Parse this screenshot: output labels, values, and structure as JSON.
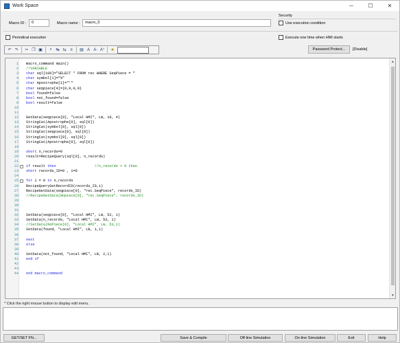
{
  "window": {
    "title": "Work Space",
    "controls": {
      "minimize": "─",
      "maximize": "☐",
      "close": "✕"
    }
  },
  "form": {
    "macro_id_label": "Macro ID :",
    "macro_id_value": "0",
    "macro_name_label": "Macro name :",
    "macro_name_value": "macro_0",
    "periodical_label": "Periodical execution",
    "security_title": "Security",
    "use_exec_condition_label": "Use execution condition",
    "execute_once_label": "Execute one time when HMI starts",
    "password_button": "Password Protect...",
    "disable_status": "[Disable]"
  },
  "toolbar": {
    "icons": [
      "undo-icon",
      "redo-icon",
      "cut-icon",
      "copy-icon",
      "paste-icon",
      "find-icon",
      "replace-icon",
      "replace-all-icon",
      "comment-icon",
      "uncomment-icon",
      "font-increase-icon",
      "font-decrease-icon",
      "font-increase-alt-icon",
      "bookmark-icon"
    ],
    "search_value": ""
  },
  "editor": {
    "lines": [
      {
        "n": "1",
        "parts": [
          [
            "pl",
            "macro_command main()"
          ]
        ]
      },
      {
        "n": "2",
        "parts": [
          [
            "cm",
            "//VARIABLE"
          ]
        ]
      },
      {
        "n": "3",
        "parts": [
          [
            "kw",
            "char"
          ],
          [
            "pl",
            " sql[100]=\"SELECT * FROM rec WHERE SeqPiece = \""
          ]
        ]
      },
      {
        "n": "4",
        "parts": [
          [
            "kw",
            "char"
          ],
          [
            "pl",
            " symbol[1]=\"%\""
          ]
        ]
      },
      {
        "n": "5",
        "parts": [
          [
            "kw",
            "char"
          ],
          [
            "pl",
            " Apostrophe[1]=\"'\""
          ]
        ]
      },
      {
        "n": "6",
        "parts": [
          [
            "kw",
            "char"
          ],
          [
            "pl",
            " seqpiece[4]={0,0,0,0}"
          ]
        ]
      },
      {
        "n": "7",
        "parts": [
          [
            "kw",
            "bool"
          ],
          [
            "pl",
            " found=false"
          ]
        ]
      },
      {
        "n": "8",
        "parts": [
          [
            "kw",
            "bool"
          ],
          [
            "pl",
            " not_found=false"
          ]
        ]
      },
      {
        "n": "9",
        "parts": [
          [
            "kw",
            "bool"
          ],
          [
            "pl",
            " result=false"
          ]
        ]
      },
      {
        "n": "10",
        "parts": []
      },
      {
        "n": "11",
        "parts": []
      },
      {
        "n": "12",
        "parts": [
          [
            "fn",
            "GetData"
          ],
          [
            "pl",
            "(seqpiece[0], \"Local HMI\", LW, 10, 4)"
          ]
        ]
      },
      {
        "n": "13",
        "parts": [
          [
            "fn",
            "StringCat"
          ],
          [
            "pl",
            "(Apostrophe[0], sql[0])"
          ]
        ]
      },
      {
        "n": "14",
        "parts": [
          [
            "fn",
            "StringCat"
          ],
          [
            "pl",
            "(symbol[0], sql[0])"
          ]
        ]
      },
      {
        "n": "15",
        "parts": [
          [
            "fn",
            "StringCat"
          ],
          [
            "pl",
            "(seqpiece[0], sql[0])"
          ]
        ]
      },
      {
        "n": "16",
        "parts": [
          [
            "fn",
            "StringCat"
          ],
          [
            "pl",
            "(symbol[0], sql[0])"
          ]
        ]
      },
      {
        "n": "17",
        "parts": [
          [
            "fn",
            "StringCat"
          ],
          [
            "pl",
            "(Apostrophe[0], sql[0])"
          ]
        ]
      },
      {
        "n": "18",
        "parts": []
      },
      {
        "n": "19",
        "parts": [
          [
            "kw",
            "short"
          ],
          [
            "pl",
            " n_records=0"
          ]
        ]
      },
      {
        "n": "20",
        "parts": [
          [
            "pl",
            "result="
          ],
          [
            "fn",
            "RecipeQuery"
          ],
          [
            "pl",
            "(sql[0], n_records)"
          ]
        ]
      },
      {
        "n": "21",
        "parts": []
      },
      {
        "n": "22",
        "fold": "-",
        "parts": [
          [
            "kw",
            "if"
          ],
          [
            "pl",
            " result "
          ],
          [
            "kw",
            "then"
          ],
          [
            "pl",
            "                  "
          ],
          [
            "cm",
            "//n_records > 0 then"
          ]
        ]
      },
      {
        "n": "23",
        "parts": [
          [
            "kw",
            "short"
          ],
          [
            "pl",
            " records_ID=0 , i=0"
          ]
        ]
      },
      {
        "n": "24",
        "parts": []
      },
      {
        "n": "25",
        "fold": "-",
        "parts": [
          [
            "kw",
            "for"
          ],
          [
            "pl",
            " i = 0 "
          ],
          [
            "kw",
            "to"
          ],
          [
            "pl",
            " n_records"
          ]
        ]
      },
      {
        "n": "26",
        "parts": [
          [
            "fn",
            "RecipeQueryGetRecordID"
          ],
          [
            "pl",
            "(records_ID,i)"
          ]
        ]
      },
      {
        "n": "27",
        "parts": [
          [
            "fn",
            "RecipeGetData"
          ],
          [
            "pl",
            "(seqpiece[0], \"rec.SeqPiece\", records_ID)"
          ]
        ]
      },
      {
        "n": "28",
        "parts": [
          [
            "cm",
            "//RecipeGetData(Nopiece[0], \"rec.SeqPiece\", records_ID)"
          ]
        ]
      },
      {
        "n": "29",
        "parts": []
      },
      {
        "n": "30",
        "parts": []
      },
      {
        "n": "31",
        "parts": []
      },
      {
        "n": "32",
        "parts": [
          [
            "fn",
            "SetData"
          ],
          [
            "pl",
            "(seqpiece[0], \"Local HMI\", LW, 52, 1)"
          ]
        ]
      },
      {
        "n": "33",
        "parts": [
          [
            "fn",
            "SetData"
          ],
          [
            "pl",
            "(n_records, \"Local HMI\", LW, 53, 1)"
          ]
        ]
      },
      {
        "n": "34",
        "parts": [
          [
            "cm",
            "//SetData(NoPiece[0], \"Local HMI\", LW, 53,1)"
          ]
        ]
      },
      {
        "n": "35",
        "parts": [
          [
            "fn",
            "SetData"
          ],
          [
            "pl",
            "(found, \"Local HMI\", LB, 1,1)"
          ]
        ]
      },
      {
        "n": "36",
        "parts": []
      },
      {
        "n": "37",
        "parts": [
          [
            "kw",
            "next"
          ]
        ]
      },
      {
        "n": "38",
        "parts": [
          [
            "kw",
            "else"
          ]
        ]
      },
      {
        "n": "39",
        "parts": []
      },
      {
        "n": "40",
        "parts": [
          [
            "fn",
            "SetData"
          ],
          [
            "pl",
            "(not_found, \"Local HMI\", LB, 2,1)"
          ]
        ]
      },
      {
        "n": "41",
        "parts": [
          [
            "kw",
            "end if"
          ]
        ]
      },
      {
        "n": "42",
        "parts": []
      },
      {
        "n": "43",
        "parts": []
      },
      {
        "n": "44",
        "parts": [
          [
            "kw",
            "end macro_command"
          ]
        ]
      }
    ]
  },
  "status": {
    "hint": "* Click the right mouse button to display edit menu."
  },
  "buttons": {
    "get_set_fn": "GET/SET FN...",
    "save_compile": "Save & Compile",
    "offline_sim": "Off-line Simulation",
    "online_sim": "On-line Simulation",
    "exit": "Exit",
    "help": "Help"
  }
}
